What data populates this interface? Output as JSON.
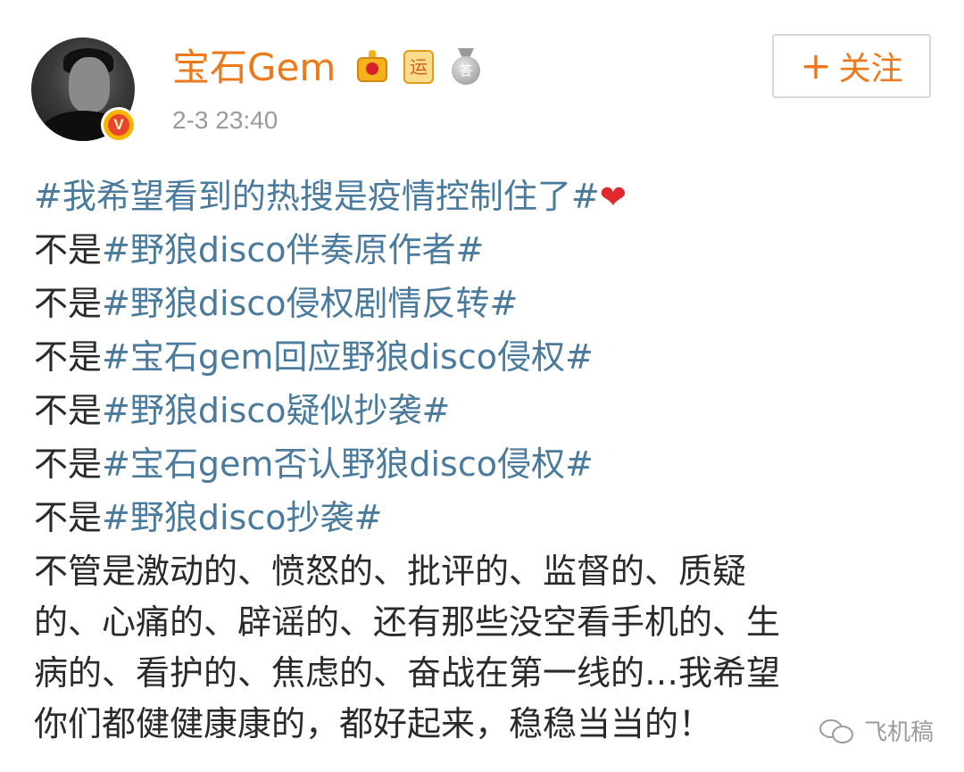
{
  "post": {
    "author": {
      "name": "宝石Gem",
      "avatar_icon": "user-avatar",
      "verified_badge": "V",
      "badges": [
        {
          "icon": "crown-icon"
        },
        {
          "icon": "yun-badge-icon",
          "label": "运"
        },
        {
          "icon": "medal-icon",
          "label": "答"
        }
      ],
      "name_color": "#ec7a1d"
    },
    "timestamp": "2-3 23:40",
    "follow_button": {
      "plus": "+",
      "label": "关注"
    },
    "content": {
      "line1": {
        "hashtag": "#我希望看到的热搜是疫情控制住了#",
        "emoji": "❤"
      },
      "not_lines": [
        {
          "prefix": "不是",
          "hashtag": "#野狼disco伴奏原作者#"
        },
        {
          "prefix": "不是",
          "hashtag": "#野狼disco侵权剧情反转#"
        },
        {
          "prefix": "不是",
          "hashtag": "#宝石gem回应野狼disco侵权#"
        },
        {
          "prefix": "不是",
          "hashtag": "#野狼disco疑似抄袭#"
        },
        {
          "prefix": "不是",
          "hashtag": "#宝石gem否认野狼disco侵权#"
        },
        {
          "prefix": "不是",
          "hashtag": "#野狼disco抄袭#"
        }
      ],
      "paragraph_lines": [
        "不管是激动的、愤怒的、批评的、监督的、质疑",
        "的、心痛的、辟谣的、还有那些没空看手机的、生",
        "病的、看护的、焦虑的、奋战在第一线的…我希望",
        "你们都健健康康的，都好起来，稳稳当当的！"
      ]
    },
    "colors": {
      "hashtag": "#4a7a9c",
      "text": "#2a2a2a",
      "timestamp": "#9a9a9a"
    }
  },
  "watermark": {
    "icon": "wechat-icon",
    "label": "飞机稿"
  }
}
